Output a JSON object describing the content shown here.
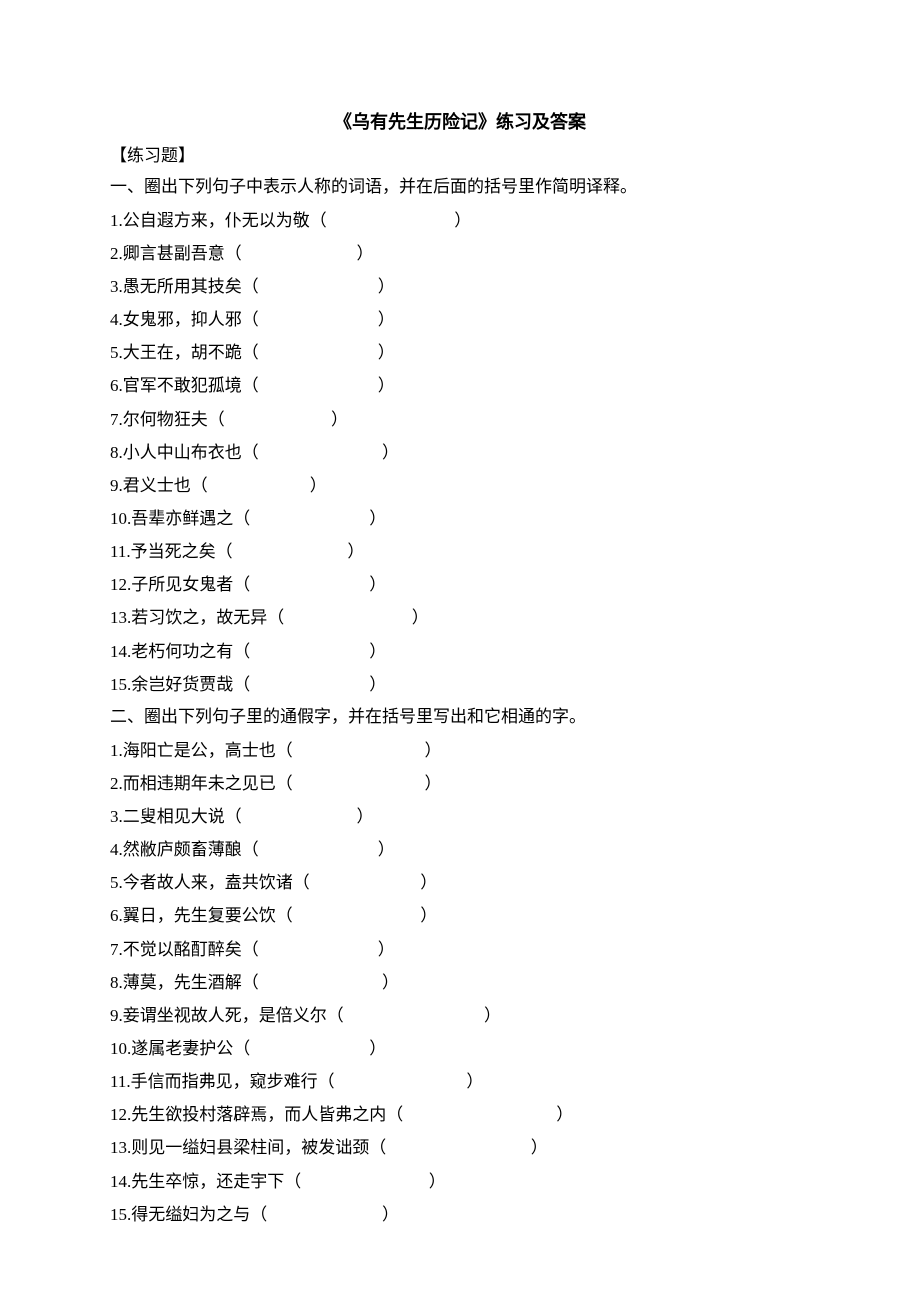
{
  "title": "《乌有先生历险记》练习及答案",
  "practice_label": "【练习题】",
  "section1": {
    "heading": "一、圈出下列句子中表示人称的词语，并在后面的括号里作简明译释。",
    "items": [
      "1.公自遐方来，仆无以为敬（                              ）",
      "2.卿言甚副吾意（                           ）",
      "3.愚无所用其技矣（                            ）",
      "4.女鬼邪，抑人邪（                            ）",
      "5.大王在，胡不跪（                            ）",
      "6.官军不敢犯孤境（                            ）",
      "7.尔何物狂夫（                         ）",
      "8.小人中山布衣也（                             ）",
      "9.君义士也（                        ）",
      "10.吾辈亦鲜遇之（                            ）",
      "11.予当死之矣（                           ）",
      "12.子所见女鬼者（                            ）",
      "13.若习饮之，故无异（                              ）",
      "14.老朽何功之有（                            ）",
      "15.余岂好货贾哉（                            ）"
    ]
  },
  "section2": {
    "heading": "二、圈出下列句子里的通假字，并在括号里写出和它相通的字。",
    "items": [
      "1.海阳亡是公，高士也（                               ）",
      "2.而相违期年未之见已（                               ）",
      "3.二叟相见大说（                           ）",
      "4.然敝庐颇畜薄酿（                            ）",
      "5.今者故人来，盍共饮诸（                          ）",
      "6.翼日，先生复要公饮（                              ）",
      "7.不觉以酩酊醉矣（                            ）",
      "8.薄莫，先生酒解（                             ）",
      "9.妾谓坐视故人死，是倍义尔（                                 ）",
      "10.遂属老妻护公（                            ）",
      "11.手信而指弗见，窥步难行（                               ）",
      "12.先生欲投村落辟焉，而人皆弗之内（                                    ）",
      "13.则见一缢妇县梁柱间，被发诎颈（                                  ）",
      "14.先生卒惊，还走宇下（                              ）",
      "15.得无缢妇为之与（                           ）"
    ]
  }
}
